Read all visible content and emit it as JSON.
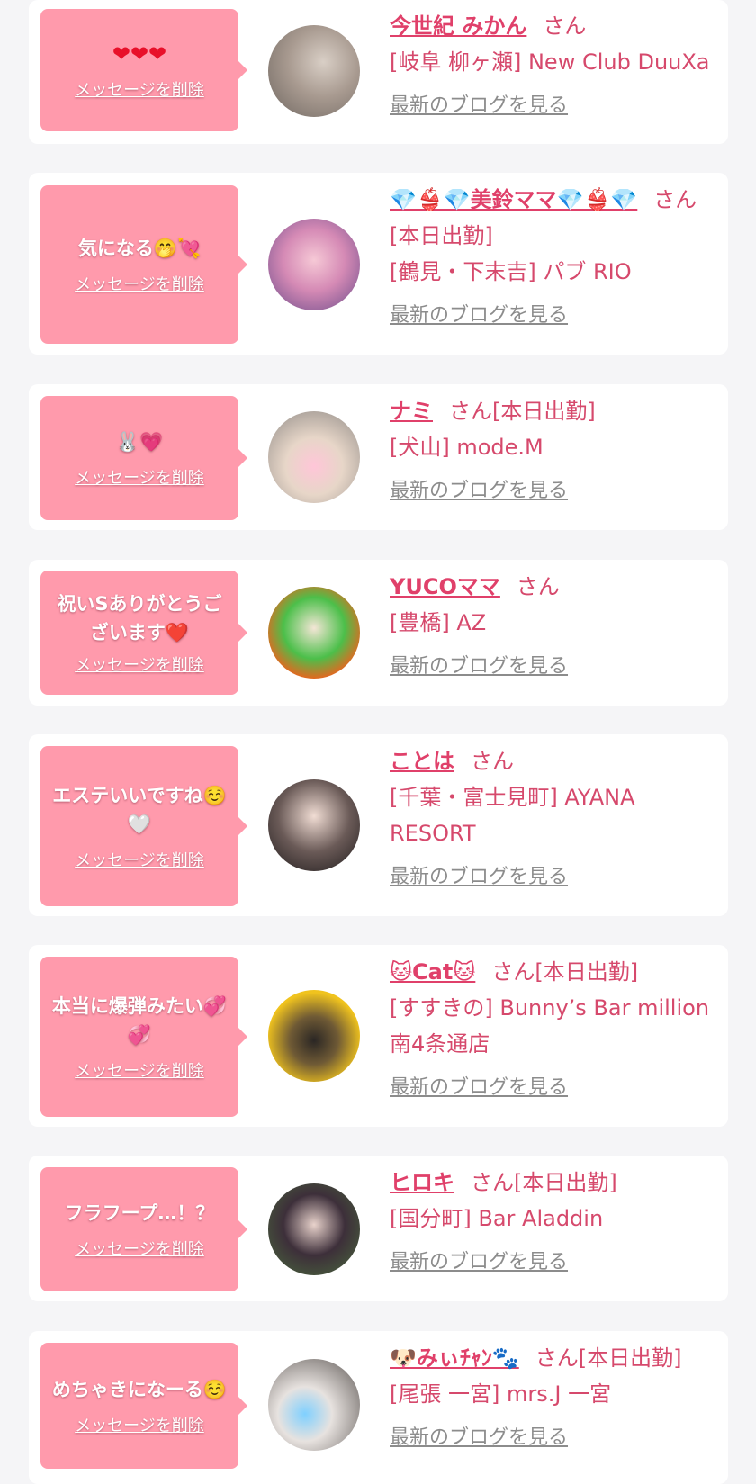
{
  "common": {
    "delete_label": "メッセージを削除",
    "blog_label": "最新のブログを見る"
  },
  "colors": {
    "bubble": "#ff9aac",
    "name": "#e0406a",
    "text": "#d6496c",
    "link_gray": "#8c8c8c",
    "card_bg": "#ffffff",
    "page_bg": "#f5f5f7"
  },
  "messages": [
    {
      "bubble_text": "❤❤❤",
      "name": "今世紀 みかん",
      "suffix": "さん",
      "shop": "[岐阜 柳ヶ瀬] New Club DuuXa"
    },
    {
      "bubble_text": "気になる🤭💘",
      "name": "💎👙💎美鈴ママ💎👙💎",
      "suffix": "さん[本日出勤]",
      "shop": "[鶴見・下末吉] パブ RIO"
    },
    {
      "bubble_text": "🐰💗",
      "name": "ナミ",
      "suffix": "さん[本日出勤]",
      "shop": "[犬山] mode.M"
    },
    {
      "bubble_text": "祝いSありがとうございます❤️",
      "name": "YUCOママ",
      "suffix": "さん",
      "shop": "[豊橋] AZ"
    },
    {
      "bubble_text": "エステいいですね☺️🤍",
      "name": "ことは",
      "suffix": "さん",
      "shop": "[千葉・富士見町] AYANA RESORT"
    },
    {
      "bubble_text": "本当に爆弾みたい💞💞",
      "name": "🐱Cat🐱",
      "suffix": "さん[本日出勤]",
      "shop": "[すすきの] Bunny’s Bar million 南4条通店"
    },
    {
      "bubble_text": "フラフープ…！？",
      "name": "ヒロキ",
      "suffix": "さん[本日出勤]",
      "shop": "[国分町] Bar Aladdin"
    },
    {
      "bubble_text": "めちゃきになーる☺️",
      "name": "🐶みぃﾁｬﾝ🐾",
      "suffix": "さん[本日出勤]",
      "shop": "[尾張 一宮] mrs.J 一宮"
    }
  ]
}
